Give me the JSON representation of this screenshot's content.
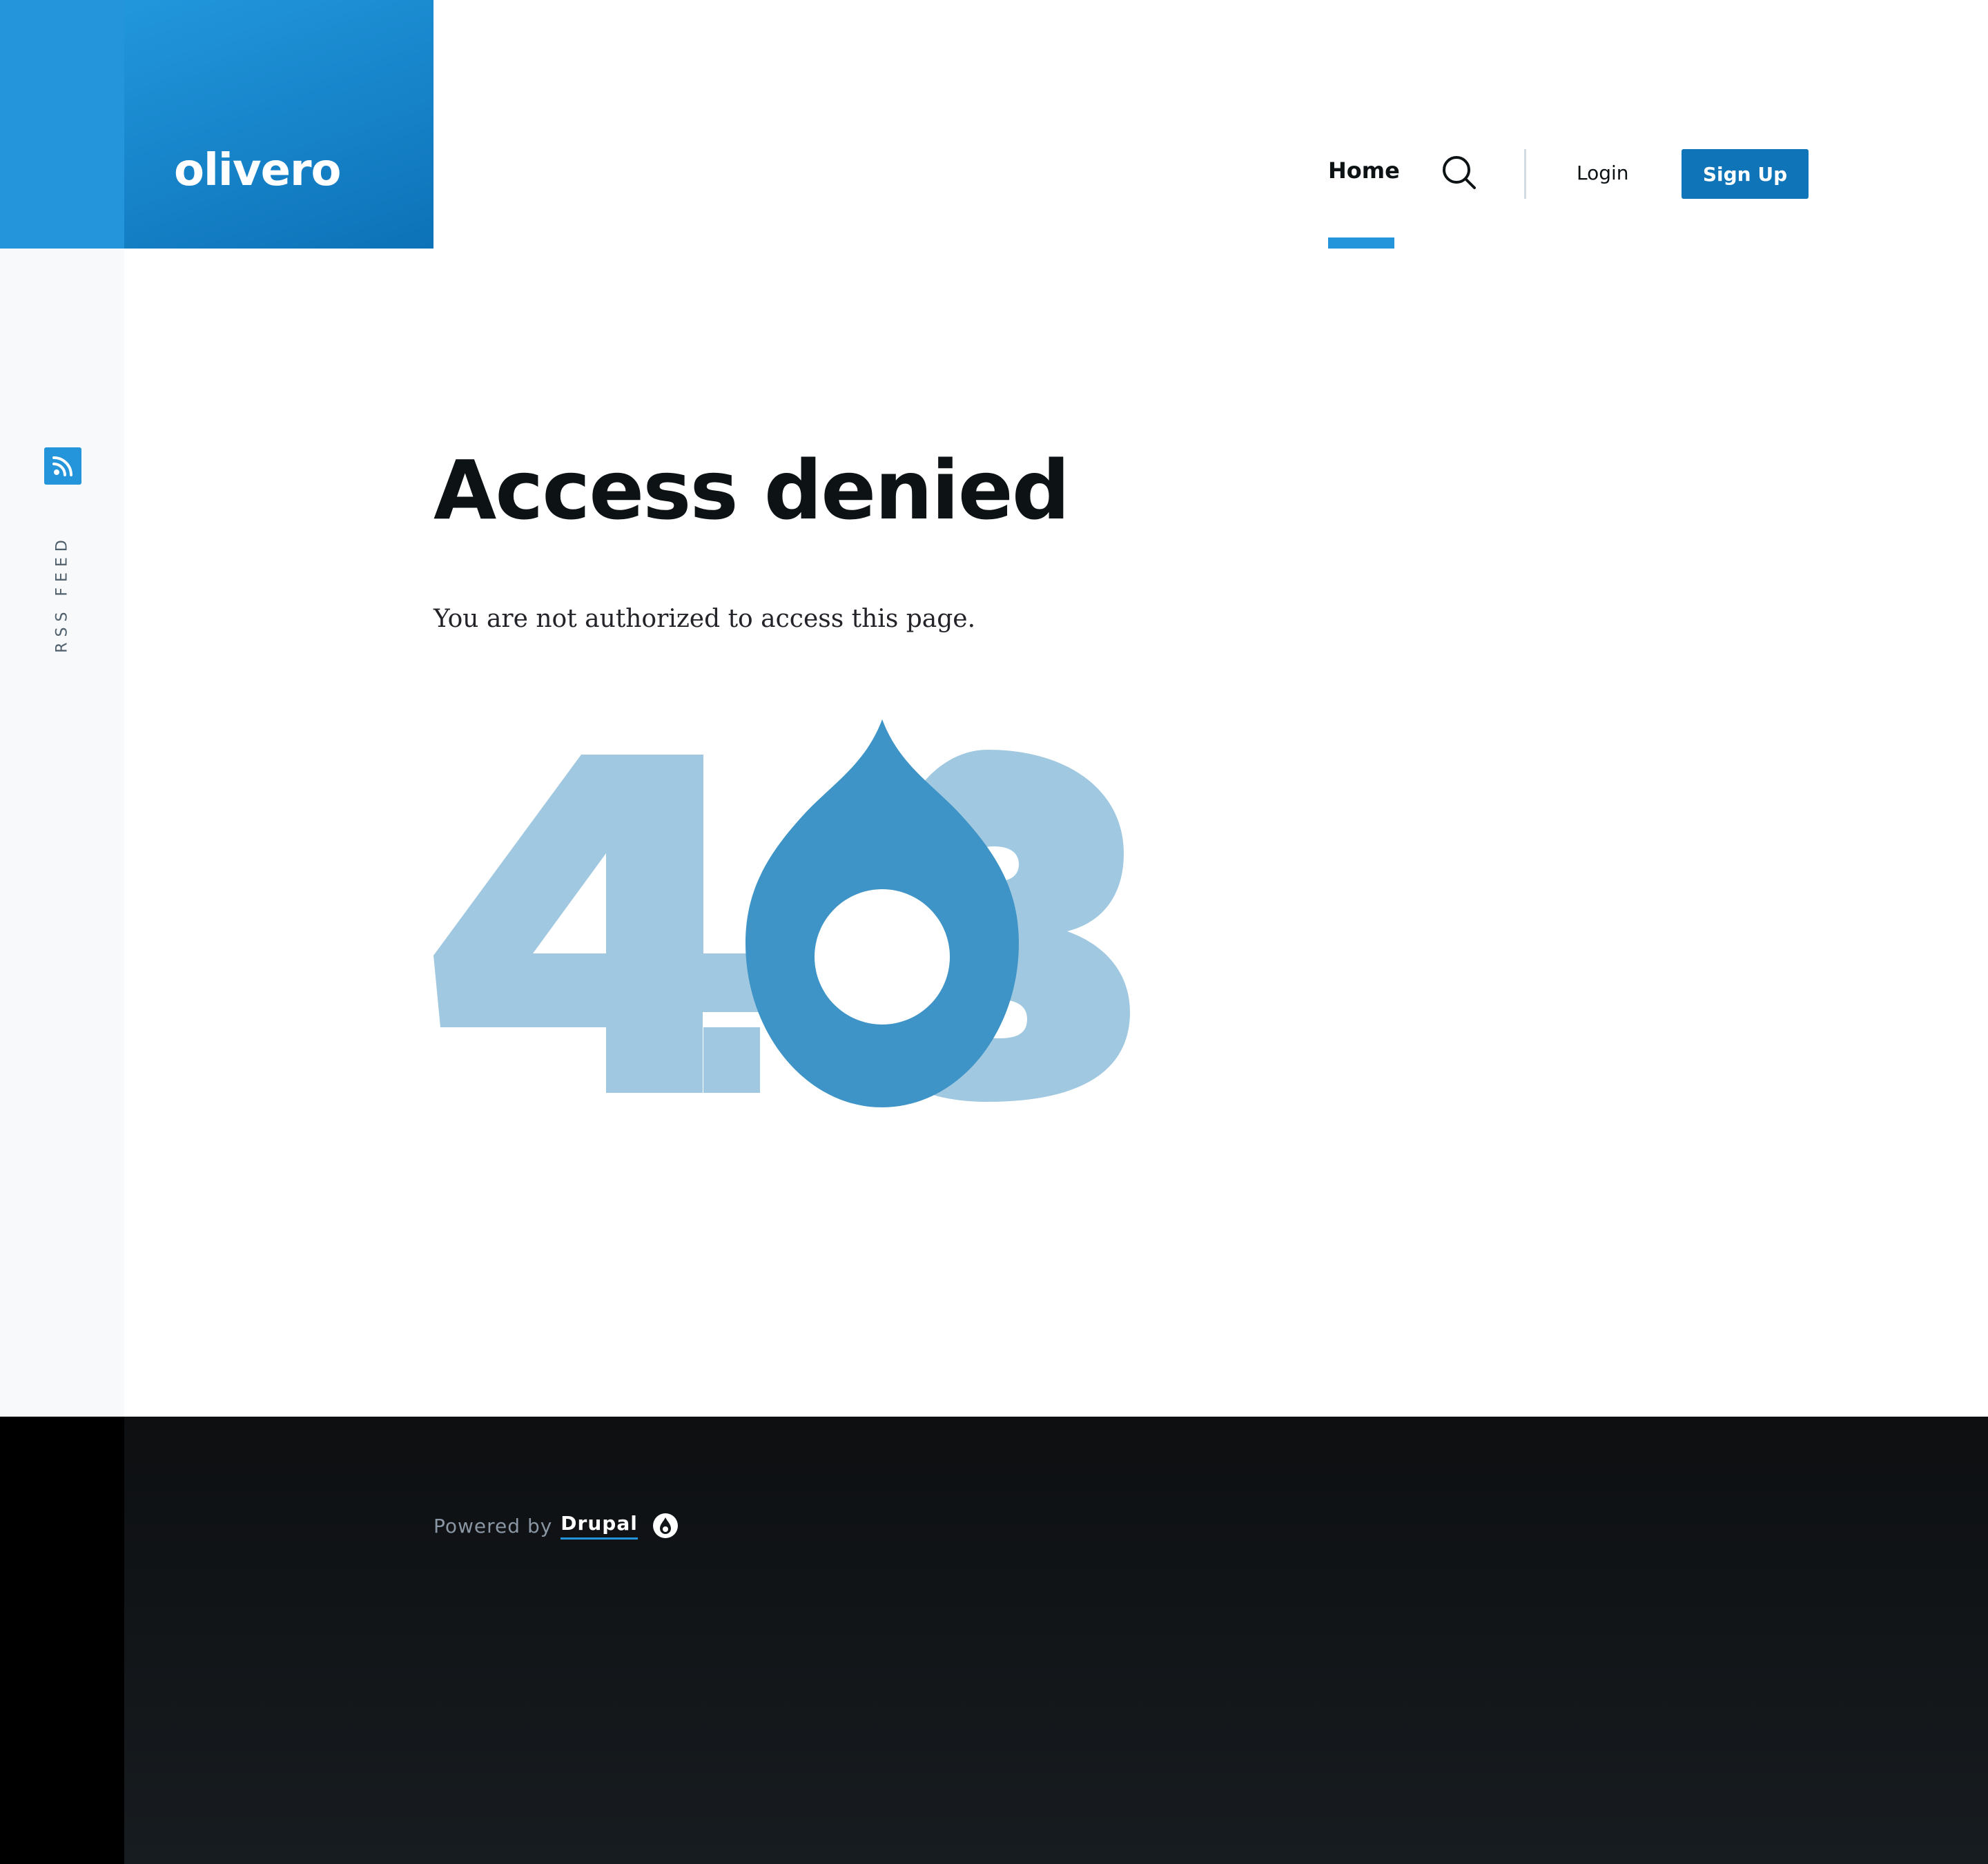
{
  "header": {
    "site_name": "olivero",
    "nav": {
      "home_label": "Home",
      "login_label": "Login",
      "signup_label": "Sign Up"
    },
    "icons": {
      "search": "search-icon"
    }
  },
  "sidebar": {
    "rss_label": "RSS FEED",
    "rss_icon": "rss-icon"
  },
  "main": {
    "title": "Access denied",
    "message": "You are not authorized to access this page.",
    "error_code": "403"
  },
  "footer": {
    "powered_by": "Powered by",
    "drupal_link": "Drupal",
    "drupal_icon": "drupal-drop-icon"
  },
  "colors": {
    "brand_blue": "#2494db",
    "button_blue": "#0f74b8",
    "text_dark": "#0d1214",
    "graphic_light": "#a0c8e0",
    "graphic_dark": "#3e94c6",
    "footer_bg": "#121619"
  }
}
